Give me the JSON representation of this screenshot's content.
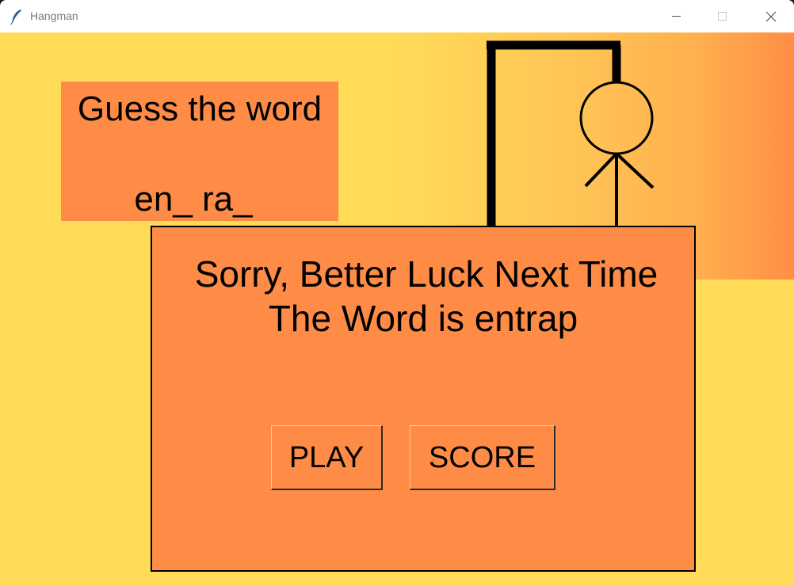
{
  "window": {
    "title": "Hangman"
  },
  "icons": {
    "app": "feather-icon",
    "minimize": "minimize-icon",
    "maximize": "maximize-icon",
    "close": "close-icon"
  },
  "colors": {
    "background": "#ffdb58",
    "panel": "#ff8c46",
    "gradient_end": "#ff8e45"
  },
  "word_panel": {
    "title": "Guess the word",
    "masked_word": "en_ ra_"
  },
  "dialog": {
    "line1": "Sorry, Better Luck Next Time",
    "line2": "The Word is entrap",
    "play_label": "PLAY",
    "score_label": "SCORE"
  }
}
